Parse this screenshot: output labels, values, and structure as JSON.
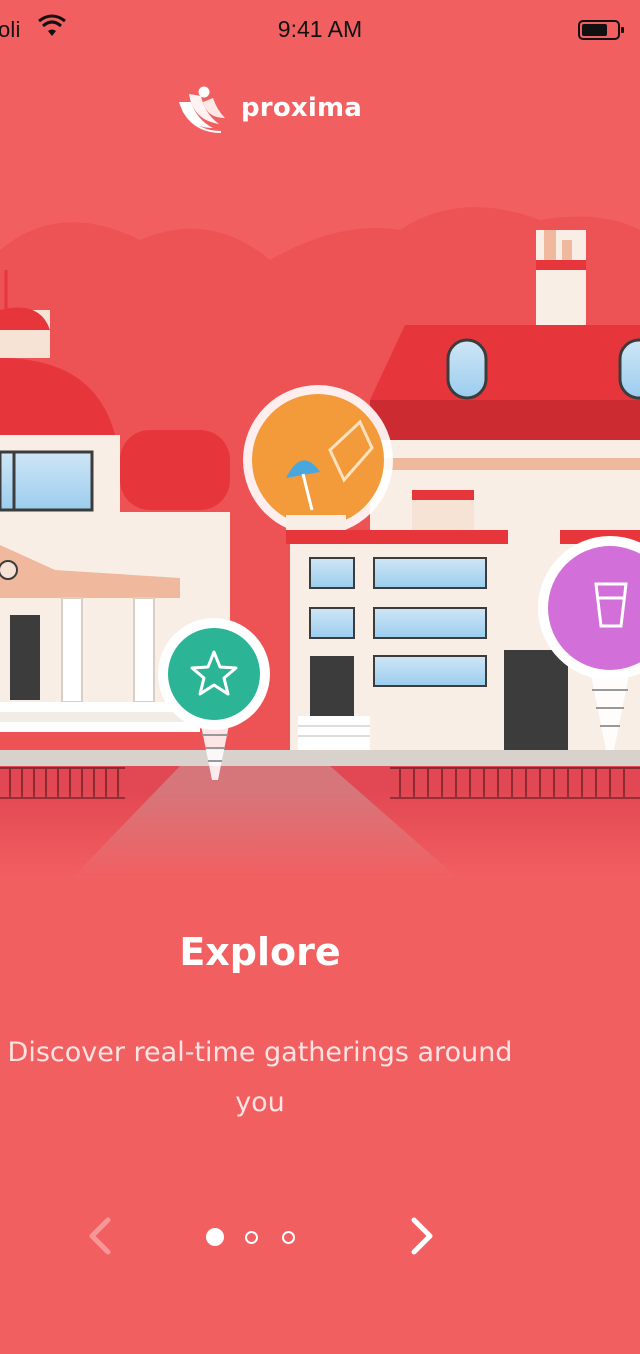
{
  "status_bar": {
    "carrier": "oli",
    "time": "9:41 AM",
    "wifi_icon": "wifi-icon",
    "battery_icon": "battery-icon"
  },
  "brand": {
    "name": "proxima",
    "logo_icon": "proxima-logo-icon"
  },
  "illustration": {
    "pins": [
      {
        "icon": "star-icon",
        "color": "#2bb596"
      },
      {
        "icon": "beach-umbrella-icon",
        "color": "#f39a3a"
      },
      {
        "icon": "cup-icon",
        "color": "#d26fd9"
      }
    ]
  },
  "onboarding": {
    "title": "Explore",
    "description": "Discover real-time gatherings around you"
  },
  "pager": {
    "pages": 3,
    "current_page": 1,
    "prev_icon": "chevron-left-icon",
    "next_icon": "chevron-right-icon"
  },
  "colors": {
    "background": "#f25f61",
    "accent_green": "#2bb596",
    "accent_orange": "#f39a3a",
    "accent_purple": "#d26fd9"
  }
}
